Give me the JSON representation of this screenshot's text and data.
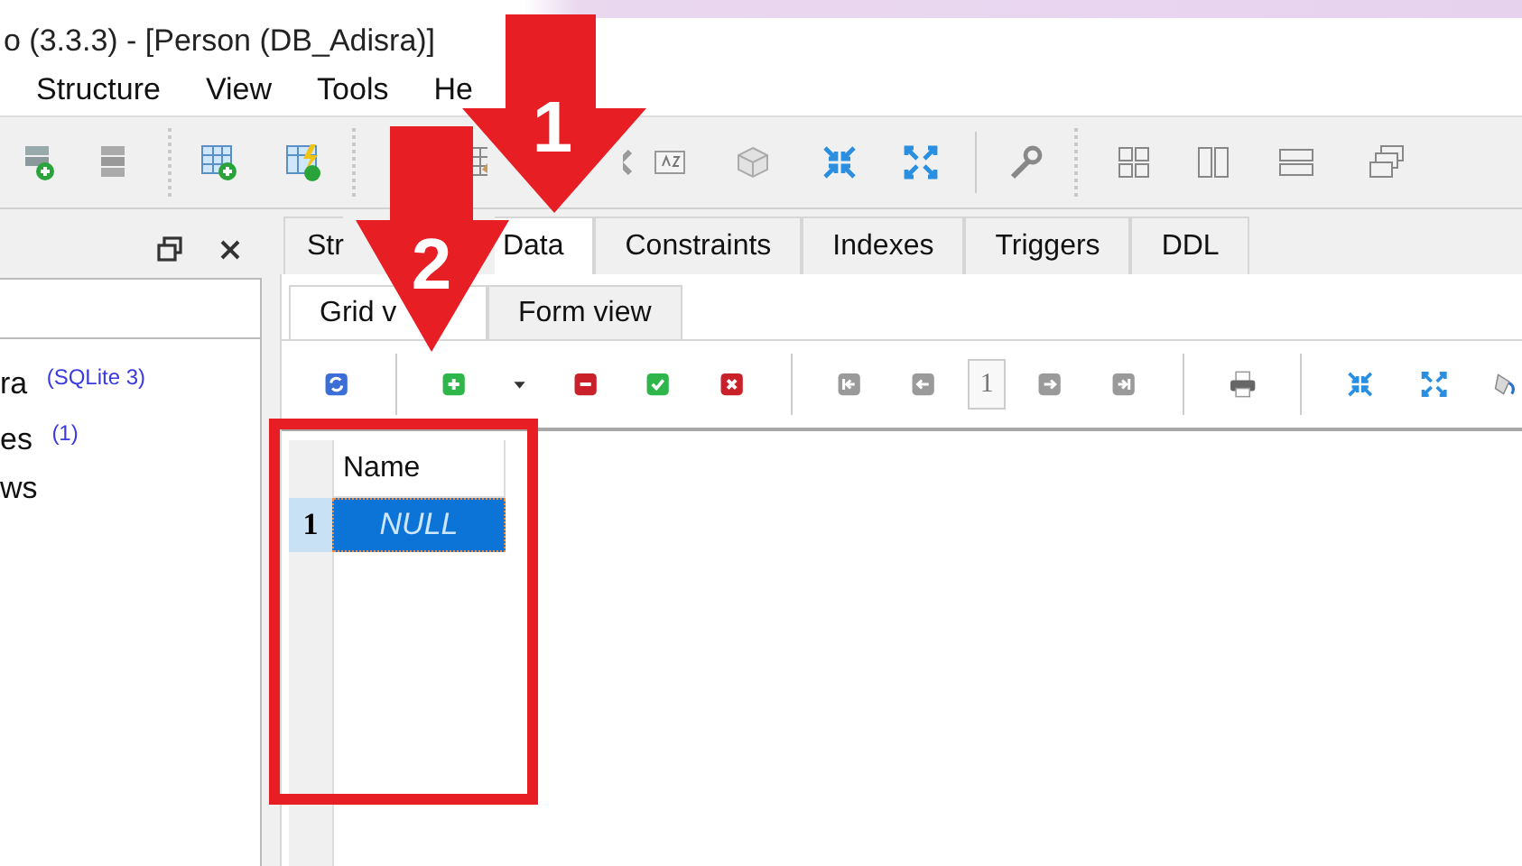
{
  "window": {
    "title": "o (3.3.3) - [Person (DB_Adisra)]"
  },
  "menu": [
    "Structure",
    "View",
    "Tools",
    "He"
  ],
  "side_panel": {
    "tree": [
      {
        "label": "ra",
        "tag": "(SQLite 3)"
      },
      {
        "label": "es",
        "tag": "(1)"
      },
      {
        "label": "ws"
      }
    ]
  },
  "tabs": [
    {
      "label": "Str",
      "selected": false
    },
    {
      "label": "Data",
      "selected": true
    },
    {
      "label": "Constraints",
      "selected": false
    },
    {
      "label": "Indexes",
      "selected": false
    },
    {
      "label": "Triggers",
      "selected": false
    },
    {
      "label": "DDL",
      "selected": false
    }
  ],
  "subtabs": [
    {
      "label": "Grid v",
      "selected": true
    },
    {
      "label": "Form view",
      "selected": false
    }
  ],
  "data_toolbar": {
    "page": "1"
  },
  "grid": {
    "columns": [
      "Name"
    ],
    "rows": [
      {
        "number": "1",
        "cells": [
          {
            "value": "NULL",
            "selected": true
          }
        ]
      }
    ]
  },
  "annotations": [
    {
      "label": "1"
    },
    {
      "label": "2"
    }
  ]
}
